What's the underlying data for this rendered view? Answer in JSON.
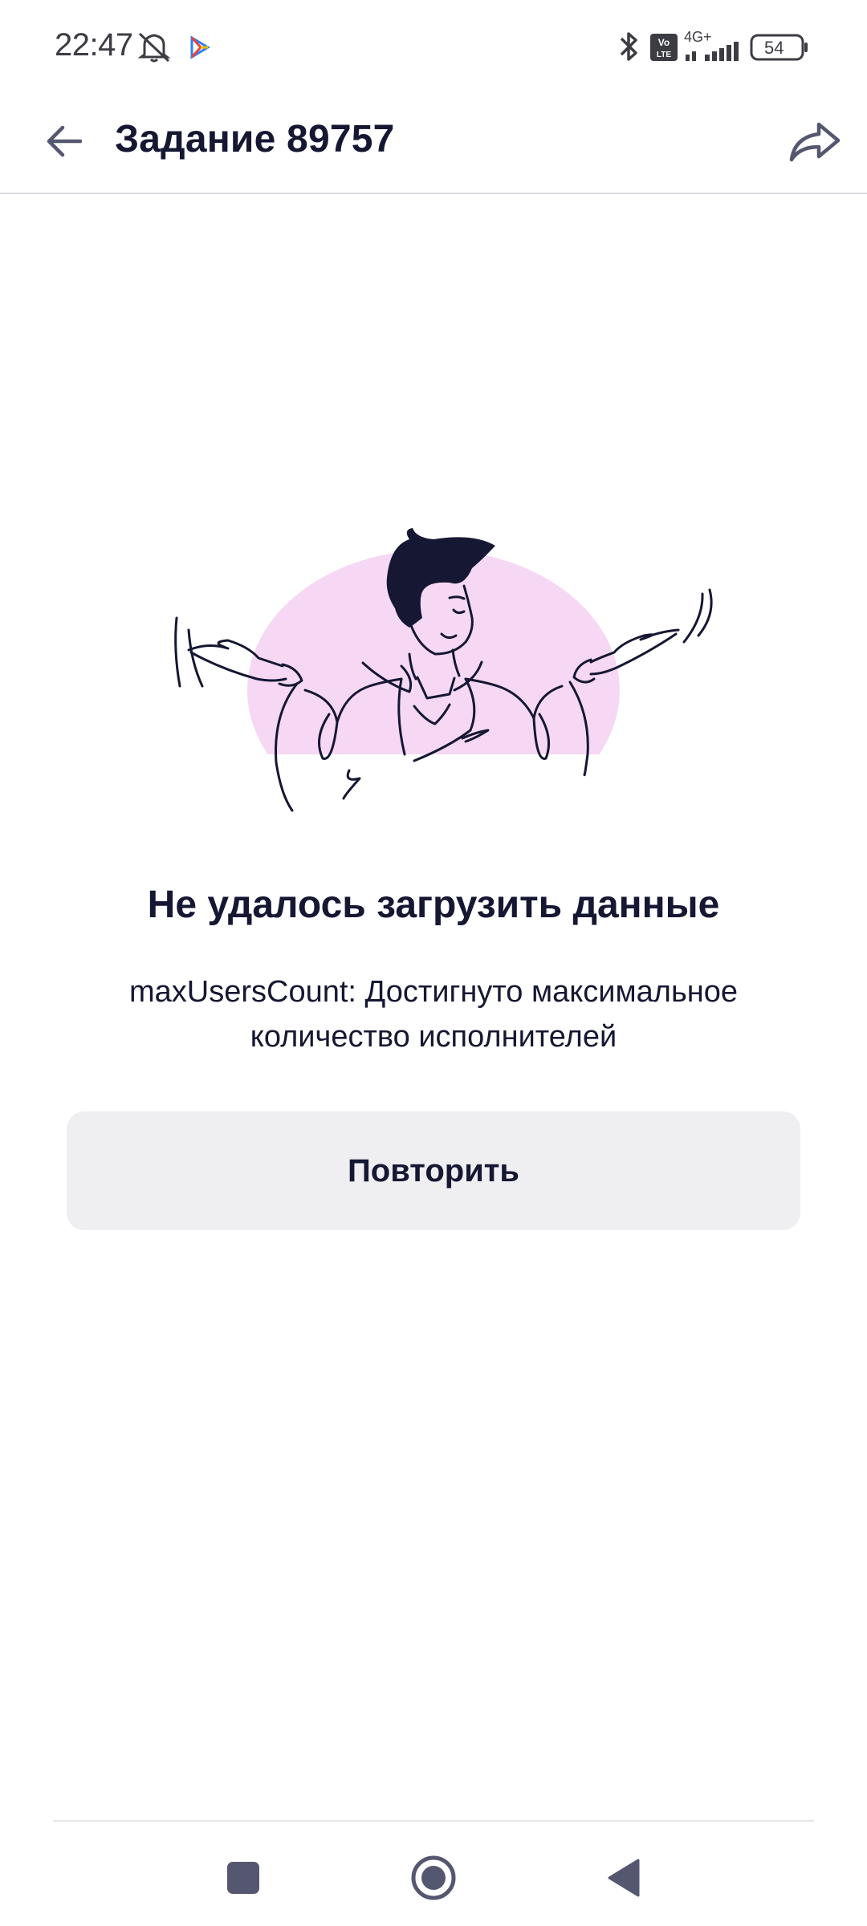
{
  "status_bar": {
    "time": "22:47",
    "network": "4G+",
    "volte": "Vo LTE",
    "battery": "54",
    "icons": [
      "mute-icon",
      "play-store-icon",
      "bluetooth-icon",
      "volte-icon",
      "signal-icon",
      "battery-icon"
    ]
  },
  "header": {
    "title": "Задание 89757",
    "back_icon": "arrow-left-icon",
    "share_icon": "share-arrow-icon"
  },
  "error": {
    "title": "Не удалось загрузить данные",
    "message_line1": "maxUsersCount: Достигнуто максимальное",
    "message_line2": "количество исполнителей",
    "retry_label": "Повторить"
  },
  "colors": {
    "text_primary": "#151733",
    "button_bg": "#efeff2",
    "illustration_blob": "#f6d8f4"
  },
  "nav": {
    "icons": [
      "recents-square-icon",
      "home-circle-icon",
      "back-triangle-icon"
    ]
  }
}
